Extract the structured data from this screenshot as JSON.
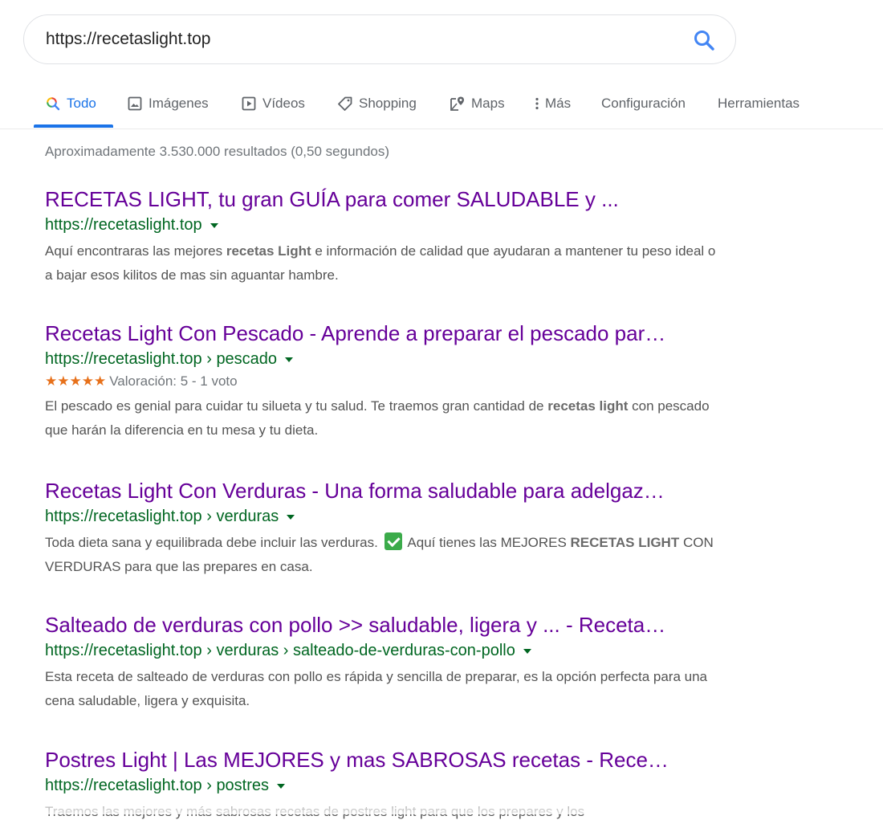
{
  "search": {
    "query": "https://recetaslight.top"
  },
  "tabs": [
    {
      "label": "Todo",
      "icon": "search-icon",
      "active": true
    },
    {
      "label": "Imágenes",
      "icon": "image-icon"
    },
    {
      "label": "Vídeos",
      "icon": "play-icon"
    },
    {
      "label": "Shopping",
      "icon": "tag-icon"
    },
    {
      "label": "Maps",
      "icon": "map-pin-icon"
    },
    {
      "label": "Más",
      "icon": "more-vert-icon"
    },
    {
      "label": "Configuración"
    },
    {
      "label": "Herramientas"
    }
  ],
  "stats": "Aproximadamente 3.530.000 resultados (0,50 segundos)",
  "results": [
    {
      "title": "RECETAS LIGHT, tu gran GUÍA para comer SALUDABLE y ...",
      "url": "https://recetaslight.top",
      "snippet": {
        "p1": "Aquí encontraras las mejores ",
        "b1": "recetas Light",
        "p2": " e información de calidad que ayudaran a mantener tu peso ideal o a bajar esos kilitos de mas sin aguantar hambre."
      }
    },
    {
      "title": "Recetas Light Con Pescado - Aprende a preparar el pescado par…",
      "url": "https://recetaslight.top › pescado",
      "rating": {
        "stars": "★★★★★",
        "text": "Valoración: 5 - 1 voto"
      },
      "snippet": {
        "p1": "El pescado es genial para cuidar tu silueta y tu salud. Te traemos gran cantidad de ",
        "b1": "recetas light",
        "p2": " con pescado que harán la diferencia en tu mesa y tu dieta."
      }
    },
    {
      "title": "Recetas Light Con Verduras - Una forma saludable para adelgaz…",
      "url": "https://recetaslight.top › verduras",
      "snippet": {
        "p1": "Toda dieta sana y equilibrada debe incluir las verduras.",
        "p2": " Aquí tienes las MEJORES ",
        "b1": "RECETAS LIGHT",
        "p3": " CON VERDURAS para que las prepares en casa."
      }
    },
    {
      "title": "Salteado de verduras con pollo >> saludable, ligera y ... - Receta…",
      "url": "https://recetaslight.top › verduras › salteado-de-verduras-con-pollo",
      "snippet": {
        "p1": "Esta receta de salteado de verduras con pollo es rápida y sencilla de preparar, es la opción perfecta para una cena saludable, ligera y exquisita."
      }
    },
    {
      "title": "Postres Light | Las MEJORES y mas SABROSAS recetas - Rece…",
      "url": "https://recetaslight.top › postres",
      "snippet": {
        "p1": "Traemos las mejores y más sabrosas recetas de postres light para que los prepares y los"
      }
    }
  ],
  "colors": {
    "accent": "#1a73e8",
    "visited_title": "#660099",
    "url_green": "#006621",
    "stars": "#e7711b",
    "check_green": "#3bab4a"
  }
}
